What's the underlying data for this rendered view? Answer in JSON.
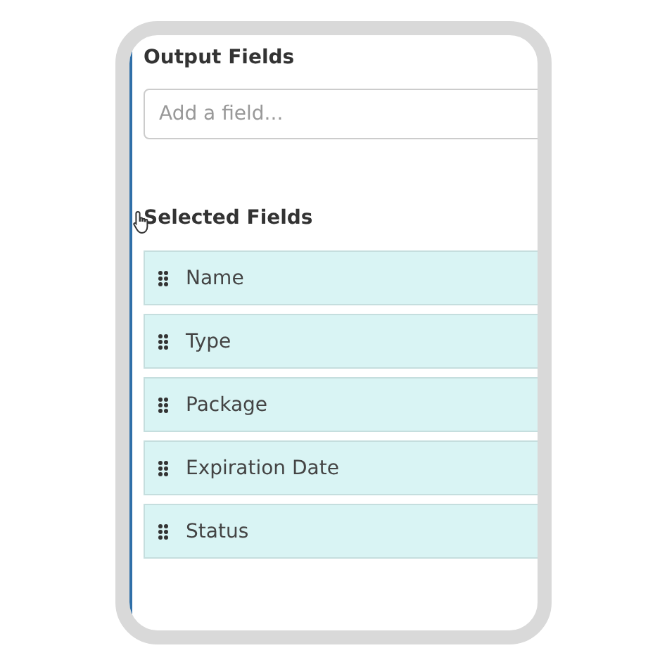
{
  "output_fields": {
    "title": "Output Fields",
    "search": {
      "placeholder": "Add a field..."
    }
  },
  "selected_fields": {
    "title": "Selected Fields",
    "items": [
      {
        "label": "Name"
      },
      {
        "label": "Type"
      },
      {
        "label": "Package"
      },
      {
        "label": "Expiration Date"
      },
      {
        "label": "Status"
      }
    ]
  }
}
